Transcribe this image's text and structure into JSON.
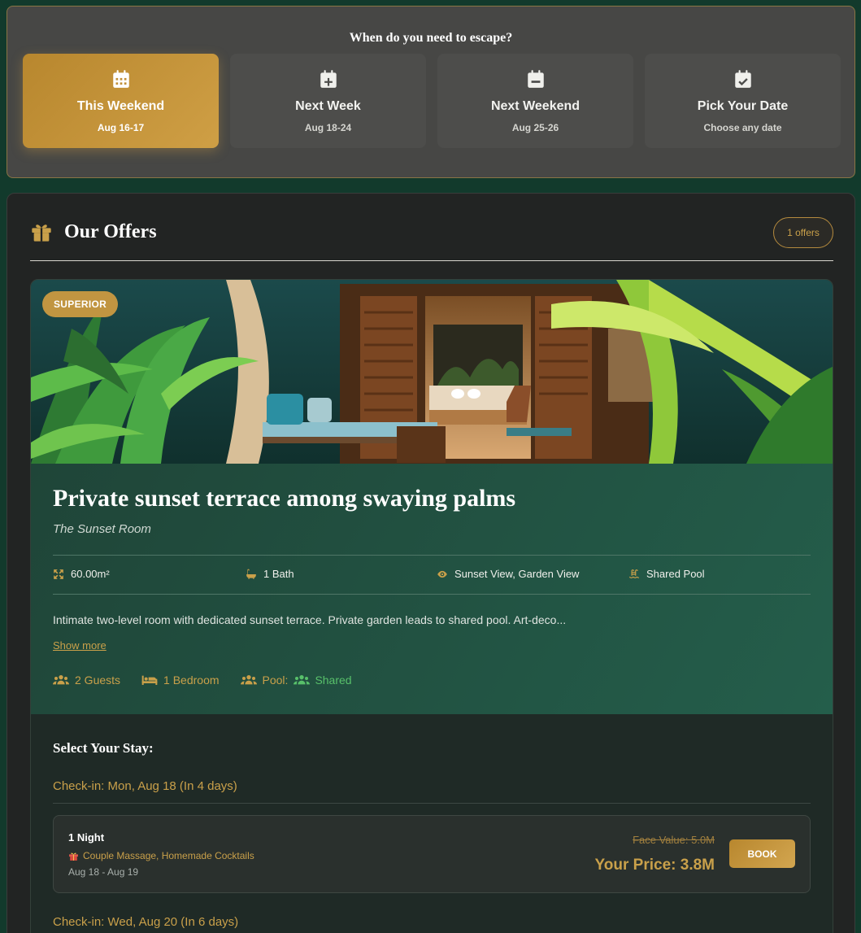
{
  "date_picker": {
    "title": "When do you need to escape?",
    "options": [
      {
        "label": "This Weekend",
        "sub": "Aug 16-17",
        "icon": "calendar-grid-icon",
        "active": true
      },
      {
        "label": "Next Week",
        "sub": "Aug 18-24",
        "icon": "calendar-plus-icon",
        "active": false
      },
      {
        "label": "Next Weekend",
        "sub": "Aug 25-26",
        "icon": "calendar-minus-icon",
        "active": false
      },
      {
        "label": "Pick Your Date",
        "sub": "Choose any date",
        "icon": "calendar-check-icon",
        "active": false
      }
    ]
  },
  "offers": {
    "title": "Our Offers",
    "count_label": "1 offers",
    "icon": "gift-icon"
  },
  "room": {
    "tier": "SUPERIOR",
    "title": "Private sunset terrace among swaying palms",
    "subtitle": "The Sunset Room",
    "features": [
      {
        "icon": "area-icon",
        "text": "60.00m²"
      },
      {
        "icon": "bath-icon",
        "text": "1 Bath"
      },
      {
        "icon": "eye-icon",
        "text": "Sunset View, Garden View"
      },
      {
        "icon": "pool-icon",
        "text": "Shared Pool"
      }
    ],
    "description": "Intimate two-level room with dedicated sunset terrace. Private garden leads to shared pool. Art-deco...",
    "show_more": "Show more",
    "tags": {
      "guests": "2 Guests",
      "bedroom": "1 Bedroom",
      "pool_label": "Pool:",
      "pool_value": "Shared"
    }
  },
  "stay": {
    "title": "Select Your Stay:",
    "checkins": [
      {
        "label": "Check-in: Mon, Aug 18 (In 4 days)",
        "options": [
          {
            "nights": "1 Night",
            "perks": "Couple Massage, Homemade Cocktails",
            "dates": "Aug 18 - Aug 19",
            "face_value": "Face Value: 5.0M",
            "price": "Your Price: 3.8M",
            "book_label": "BOOK"
          }
        ]
      },
      {
        "label": "Check-in: Wed, Aug 20 (In 6 days)"
      }
    ]
  },
  "colors": {
    "accent_gold": "#c9a04a",
    "panel_bg": "#222423",
    "room_green": "#245e4b",
    "page_bg": "#123a2c"
  }
}
